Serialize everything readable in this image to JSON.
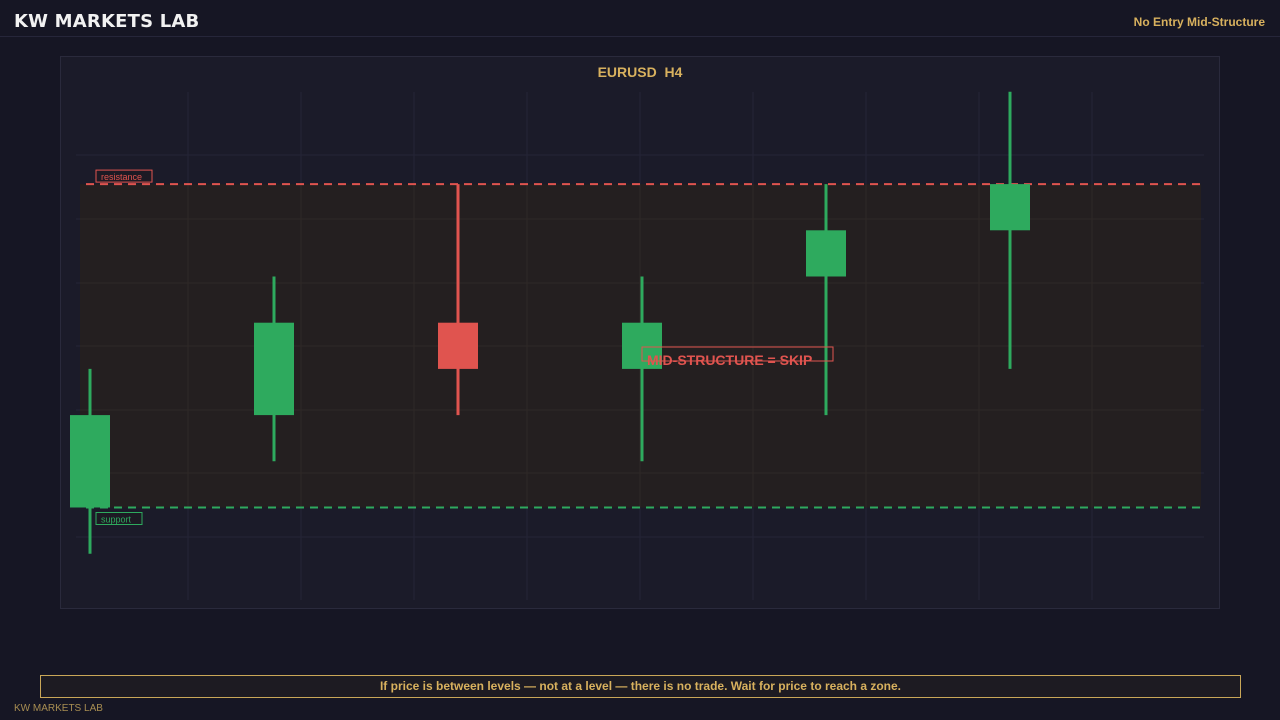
{
  "header": {
    "brand": "KW MARKETS LAB",
    "subtitle": "No Entry Mid-Structure"
  },
  "colors": {
    "bull": "#2eaa5e",
    "bear": "#e0544f",
    "resistance": "#e0544f",
    "support": "#2eaa5e",
    "accent": "#d8b15e"
  },
  "chart_data": {
    "type": "candlestick",
    "title": "EURUSD  H4",
    "grid": true,
    "candles": [
      {
        "open": 2,
        "close": 4,
        "high": 5,
        "low": 1
      },
      {
        "open": 4,
        "close": 6,
        "high": 7,
        "low": 3
      },
      {
        "open": 6,
        "close": 5,
        "high": 9,
        "low": 4
      },
      {
        "open": 5,
        "close": 6,
        "high": 7,
        "low": 3
      },
      {
        "open": 7,
        "close": 8,
        "high": 9,
        "low": 4
      },
      {
        "open": 8,
        "close": 9,
        "high": 11,
        "low": 5
      }
    ],
    "levels": {
      "resistance": {
        "value": 9,
        "label": "resistance"
      },
      "support": {
        "value": 2,
        "label": "support"
      }
    },
    "annotation": "MID-STRUCTURE = SKIP"
  },
  "footer": {
    "note": "If price is between levels — not at a level — there is no trade. Wait for price to reach a zone.",
    "brand": "KW MARKETS LAB"
  }
}
